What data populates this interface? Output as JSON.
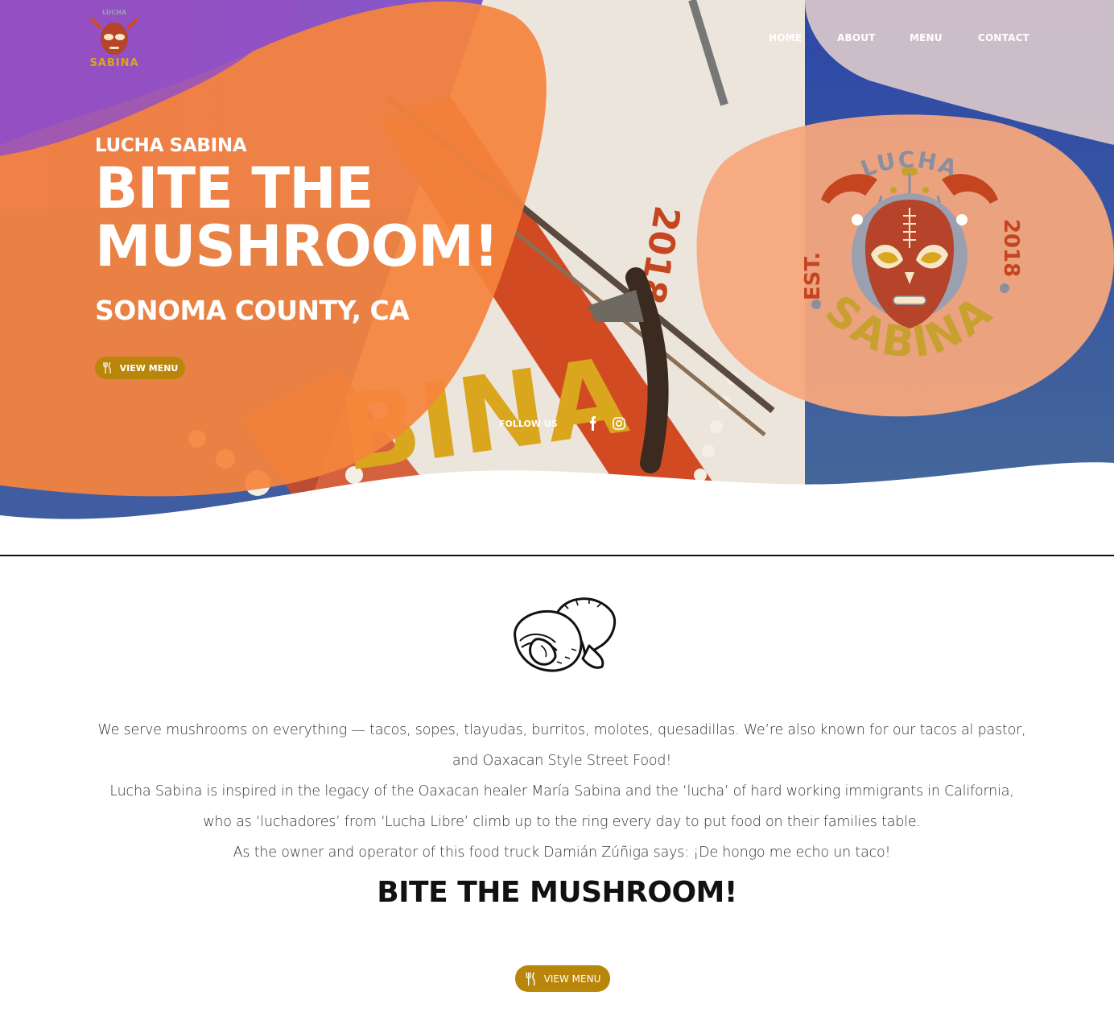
{
  "brand": {
    "logo_lettering": [
      "LUCHA",
      "SABINA",
      "EST.",
      "2018"
    ]
  },
  "nav": {
    "items": [
      {
        "label": "HOME"
      },
      {
        "label": "ABOUT"
      },
      {
        "label": "MENU"
      },
      {
        "label": "CONTACT"
      }
    ]
  },
  "hero": {
    "brand": "LUCHA SABINA",
    "title": "BITE THE\nMUSHROOM!",
    "subtitle": "SONOMA COUNTY, CA",
    "button_label": "VIEW MENU",
    "follow_label": "FOLLOW US",
    "social_icons": [
      "facebook-icon",
      "instagram-icon"
    ],
    "truck_lettering": [
      "2018",
      "BINA"
    ]
  },
  "about": {
    "paragraphs": [
      "We serve mushrooms on everything — tacos, sopes, tlayudas, burritos, molotes, quesadillas. We’re also known for our tacos al pastor, and Oaxacan Style Street Food!",
      "Lucha Sabina is inspired in the legacy of the Oaxacan healer María Sabina and the ‘lucha’ of hard working immigrants in California, who as ‘luchadores’ from ‘Lucha Libre’ climb up to the ring every day to put food on their families table.",
      "As the owner and operator of this food truck Damián Zúñiga says: ¡De hongo me echo un taco!"
    ],
    "title": "BITE THE MUSHROOM!",
    "button_label": "VIEW MENU"
  },
  "colors": {
    "accent_gold": "#b8860b",
    "orange": "#f5843c",
    "peach": "#f7a77c",
    "purple": "#8a4fc2",
    "navy": "#2f4d8f",
    "mask_red": "#b5442a"
  }
}
